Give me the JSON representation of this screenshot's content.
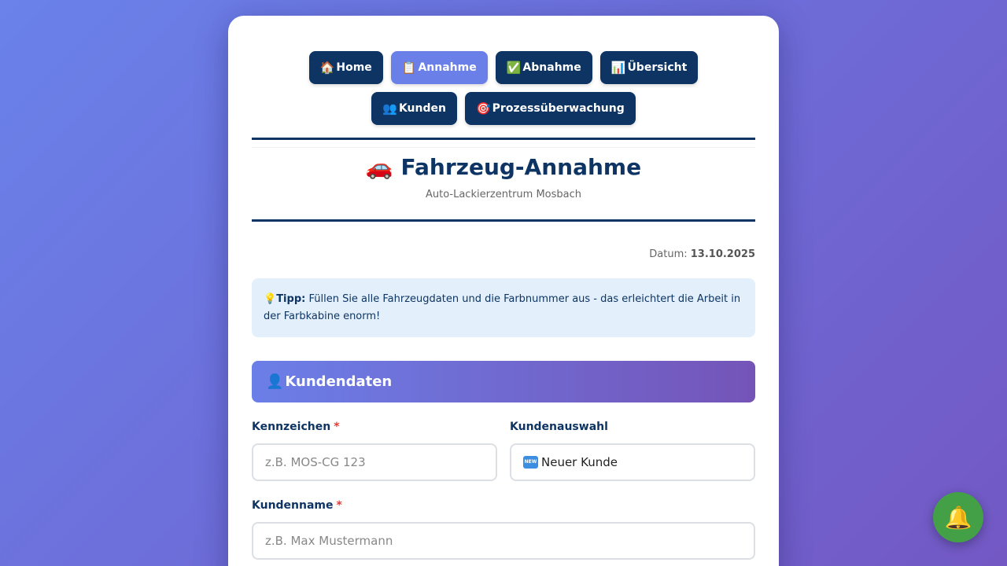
{
  "nav": {
    "row1": [
      {
        "icon": "🏠",
        "label": "Home",
        "active": false
      },
      {
        "icon": "📋",
        "label": "Annahme",
        "active": true
      },
      {
        "icon": "✅",
        "label": "Abnahme",
        "active": false
      },
      {
        "icon": "📊",
        "label": "Übersicht",
        "active": false
      }
    ],
    "row2": [
      {
        "icon": "👥",
        "label": "Kunden",
        "active": false
      },
      {
        "icon": "🎯",
        "label": "Prozessüberwachung",
        "active": false
      }
    ]
  },
  "header": {
    "icon": "🚗",
    "title": "Fahrzeug-Annahme",
    "subtitle": "Auto-Lackierzentrum Mosbach"
  },
  "date": {
    "label": "Datum:",
    "value": "13.10.2025"
  },
  "tip": {
    "icon": "💡",
    "label": "Tipp:",
    "text": "Füllen Sie alle Fahrzeugdaten und die Farbnummer aus - das erleichtert die Arbeit in der Farbkabine enorm!"
  },
  "section": {
    "icon": "👤",
    "title": "Kundendaten"
  },
  "fields": {
    "kennzeichen": {
      "label": "Kennzeichen",
      "required": "*",
      "placeholder": "z.B. MOS-CG 123"
    },
    "kundenauswahl": {
      "label": "Kundenauswahl",
      "badge": "NEW",
      "value": "Neuer Kunde"
    },
    "kundenname": {
      "label": "Kundenname",
      "required": "*",
      "placeholder": "z.B. Max Mustermann"
    }
  },
  "notification": {
    "icon": "🔔",
    "icon_name": "bell-icon"
  },
  "colors": {
    "primary": "#0d3463",
    "accent": "#6b7fe8",
    "notify": "#43a047"
  }
}
